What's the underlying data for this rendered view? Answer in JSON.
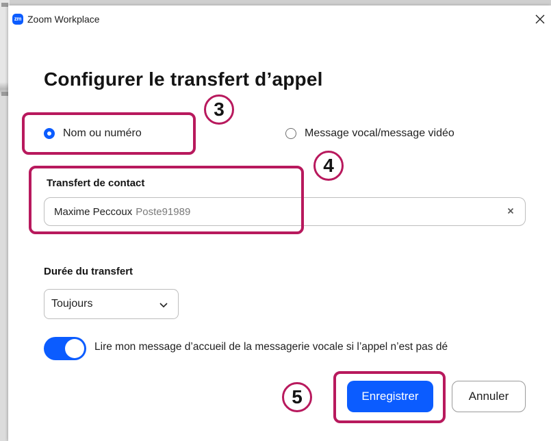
{
  "window": {
    "app_logo": "zm",
    "title": "Zoom Workplace",
    "close_icon": "close-icon"
  },
  "dialog": {
    "heading": "Configurer le transfert d’appel",
    "radio_options": [
      {
        "label": "Nom ou numéro",
        "selected": true
      },
      {
        "label": "Message vocal/message vidéo",
        "selected": false
      }
    ],
    "contact_section": {
      "label": "Transfert de contact",
      "contact_name": "Maxime Peccoux",
      "contact_extension": "Poste91989",
      "clear_icon": "clear-icon"
    },
    "duration_section": {
      "label": "Durée du transfert",
      "selected_value": "Toujours",
      "chevron_icon": "chevron-down-icon"
    },
    "greeting_toggle": {
      "enabled": true,
      "text": "Lire mon message d’accueil de la messagerie vocale si l’appel n’est pas dé"
    },
    "buttons": {
      "save_label": "Enregistrer",
      "cancel_label": "Annuler"
    }
  },
  "annotations": {
    "step_3": "3",
    "step_4": "4",
    "step_5": "5",
    "highlight_color": "#b8195d"
  },
  "colors": {
    "accent": "#0b5cff",
    "annotation": "#b8195d"
  }
}
